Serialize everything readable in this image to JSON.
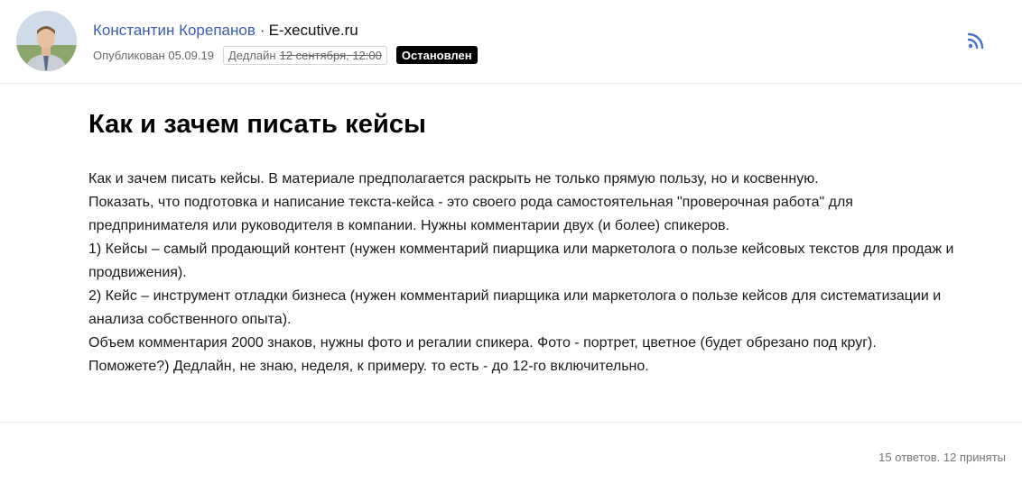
{
  "author": {
    "name": "Константин Корепанов",
    "separator": "·",
    "company": "E-xecutive.ru"
  },
  "meta": {
    "published": "Опубликован 05.09.19",
    "deadline_label": "Дедлайн",
    "deadline_date": "12 сентября, 12:00",
    "status": "Остановлен"
  },
  "icons": {
    "rss": "rss-icon",
    "avatar": "avatar"
  },
  "colors": {
    "author_link": "#3b5bb5",
    "rss": "#4a6fd1",
    "status_bg": "#000000"
  },
  "article": {
    "title": "Как и зачем писать кейсы",
    "paragraphs": [
      "Как и зачем писать кейсы. В материале предполагается раскрыть не только прямую пользу, но и косвенную.",
      "Показать, что подготовка и написание текста-кейса - это своего рода самостоятельная \"проверочная работа\" для предпринимателя или руководителя в компании. Нужны комментарии двух (и более) спикеров.",
      "1) Кейсы – самый продающий контент (нужен комментарий пиарщика или маркетолога о пользе кейсовых текстов для продаж и продвижения).",
      "2) Кейс – инструмент отладки бизнеса (нужен комментарий пиарщика или маркетолога о пользе кейсов для систематизации и анализа собственного опыта).",
      "Объем комментария 2000 знаков, нужны фото и регалии спикера. Фото - портрет, цветное (будет обрезано под круг).",
      "Поможете?) Дедлайн, не знаю, неделя, к примеру. то есть - до 12-го включительно."
    ]
  },
  "footer": {
    "stats": "15 ответов. 12 приняты"
  }
}
